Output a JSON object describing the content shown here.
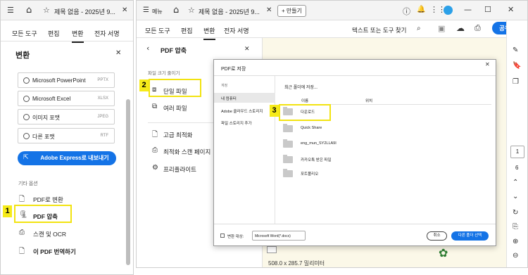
{
  "left_window": {
    "tab_title": "제목 없음 - 2025년 9...",
    "tabs": [
      "모든 도구",
      "편집",
      "변환",
      "전자 서명"
    ],
    "panel_title": "변환",
    "formats": [
      {
        "label": "Microsoft PowerPoint",
        "ext": "PPTX"
      },
      {
        "label": "Microsoft Excel",
        "ext": "XLSX"
      },
      {
        "label": "이미지 포맷",
        "ext": "JPEG"
      },
      {
        "label": "다른 포맷",
        "ext": "RTF"
      }
    ],
    "export_button": "Adobe Express로 내보내기",
    "other_options_header": "기타 옵션",
    "options": [
      "PDF로 변환",
      "PDF 압축",
      "스캔 및 OCR",
      "이 PDF 번역하기"
    ]
  },
  "right_window": {
    "menu_label": "메뉴",
    "tab_title": "제목 없음 - 2025년 9...",
    "new_tab": "+ 만들기",
    "tabs": [
      "모든 도구",
      "편집",
      "변환",
      "전자 서명"
    ],
    "search_placeholder": "텍스트 또는 도구 찾기",
    "share_button": "공유",
    "panel_title": "PDF 압축",
    "reduce_header": "파일 크기 줄이기",
    "single_file": "단일 파일",
    "multiple_files": "여러 파일",
    "advanced_optimize": "고급 최적화",
    "optimize_scanned": "최적화 스캔 페이지",
    "preflight": "프리플라이트",
    "page_size": "508.0 x 285.7 밀리미터",
    "page_number": "1",
    "page_total": "6"
  },
  "dialog": {
    "title": "PDF로 저장",
    "nav_header": "계정",
    "nav_items": [
      "내 컴퓨터",
      "Adobe 클라우드 스토리지",
      "파일 스토리지 추가"
    ],
    "recent_label": "최근 폴더에 저장...",
    "col_name": "이름",
    "col_location": "위치",
    "folders": [
      "다운로드",
      "Quick Share",
      "eng_mun_SY2LLA9I",
      "카카오톡 받은 파일",
      "포트폴리오"
    ],
    "convert_label": "변환 대상:",
    "convert_value": "Microsoft Word(*.docx)",
    "cancel": "취소",
    "choose_folder": "다른 폴더 선택"
  },
  "callouts": [
    "1",
    "2",
    "3"
  ],
  "colors": {
    "accent": "#1473e6",
    "highlight": "#f2e311",
    "badge": "#f6eb19"
  }
}
